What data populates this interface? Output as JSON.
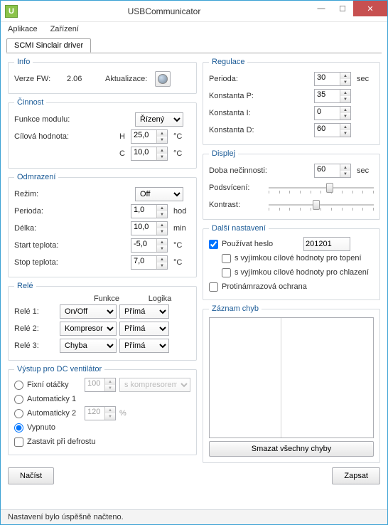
{
  "window": {
    "title": "USBCommunicator"
  },
  "menu": {
    "app": "Aplikace",
    "device": "Zařízení"
  },
  "tab": {
    "label": "SCMI Sinclair driver"
  },
  "info": {
    "legend": "Info",
    "fw_label": "Verze FW:",
    "fw_value": "2.06",
    "update_label": "Aktualizace:"
  },
  "activity": {
    "legend": "Činnost",
    "module_label": "Funkce modulu:",
    "module_value": "Řízený",
    "target_label": "Cílová hodnota:",
    "h_label": "H",
    "h_value": "25,0",
    "h_unit": "°C",
    "c_label": "C",
    "c_value": "10,0",
    "c_unit": "°C"
  },
  "defrost": {
    "legend": "Odmrazení",
    "mode_label": "Režim:",
    "mode_value": "Off",
    "period_label": "Perioda:",
    "period_value": "1,0",
    "period_unit": "hod",
    "length_label": "Délka:",
    "length_value": "10,0",
    "length_unit": "min",
    "start_label": "Start teplota:",
    "start_value": "-5,0",
    "start_unit": "°C",
    "stop_label": "Stop teplota:",
    "stop_value": "7,0",
    "stop_unit": "°C"
  },
  "relay": {
    "legend": "Relé",
    "col_func": "Funkce",
    "col_logic": "Logika",
    "rows": [
      {
        "label": "Relé 1:",
        "func": "On/Off",
        "logic": "Přímá"
      },
      {
        "label": "Relé 2:",
        "func": "Kompresor",
        "logic": "Přímá"
      },
      {
        "label": "Relé 3:",
        "func": "Chyba",
        "logic": "Přímá"
      }
    ]
  },
  "fan": {
    "legend": "Výstup pro DC ventilátor",
    "opt_fixed": "Fixní otáčky",
    "fixed_val": "100",
    "fixed_sel": "s kompresorem",
    "opt_auto1": "Automaticky 1",
    "opt_auto2": "Automaticky 2",
    "auto2_val": "120",
    "auto2_unit": "%",
    "opt_off": "Vypnuto",
    "chk_stop": "Zastavit při defrostu"
  },
  "regulation": {
    "legend": "Regulace",
    "period_label": "Perioda:",
    "period_value": "30",
    "period_unit": "sec",
    "p_label": "Konstanta P:",
    "p_value": "35",
    "i_label": "Konstanta I:",
    "i_value": "0",
    "d_label": "Konstanta D:",
    "d_value": "60"
  },
  "display": {
    "legend": "Displej",
    "idle_label": "Doba nečinnosti:",
    "idle_value": "60",
    "idle_unit": "sec",
    "backlight_label": "Podsvícení:",
    "contrast_label": "Kontrast:"
  },
  "other": {
    "legend": "Další nastavení",
    "chk_pwd": "Používat heslo",
    "pwd_value": "201201",
    "chk_except_heat": "s vyjímkou cílové hodnoty pro topení",
    "chk_except_cool": "s vyjímkou cílové hodnoty pro chlazení",
    "chk_antifreeze": "Protinámrazová ochrana"
  },
  "errors": {
    "legend": "Záznam chyb",
    "clear_btn": "Smazat všechny chyby"
  },
  "buttons": {
    "read": "Načíst",
    "write": "Zapsat"
  },
  "status": "Nastavení bylo úspěšně načteno."
}
